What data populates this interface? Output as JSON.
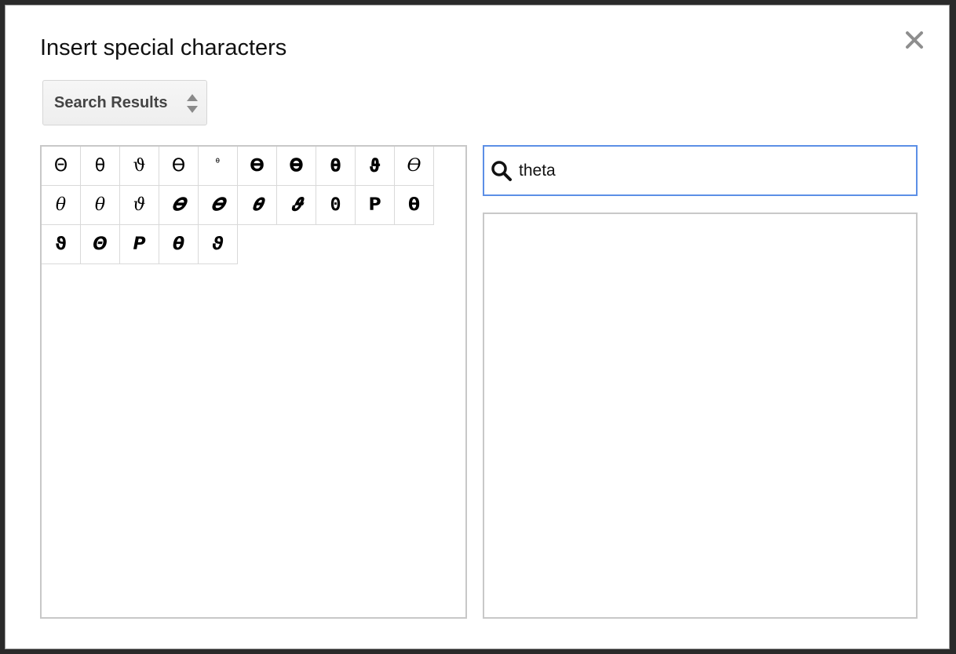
{
  "dialog": {
    "title": "Insert special characters",
    "close_icon": "close-icon"
  },
  "category_select": {
    "selected": "Search Results",
    "icon": "updown-arrows-icon"
  },
  "characters": [
    {
      "glyph": "Θ",
      "style": ""
    },
    {
      "glyph": "θ",
      "style": ""
    },
    {
      "glyph": "ϑ",
      "style": "c-serif"
    },
    {
      "glyph": "ϴ",
      "style": ""
    },
    {
      "glyph": "ᶿ",
      "style": "c-small"
    },
    {
      "glyph": "𝚯",
      "style": "c-bold"
    },
    {
      "glyph": "𝚹",
      "style": "c-bold"
    },
    {
      "glyph": "𝛉",
      "style": "c-bold"
    },
    {
      "glyph": "𝛝",
      "style": "c-bold"
    },
    {
      "glyph": "𝛳",
      "style": "c-italic c-serif"
    },
    {
      "glyph": "𝜃",
      "style": "c-italic c-serif"
    },
    {
      "glyph": "𝜃",
      "style": "c-italic c-serif"
    },
    {
      "glyph": "𝜗",
      "style": "c-italic c-serif"
    },
    {
      "glyph": "𝜭",
      "style": "c-bold c-italic"
    },
    {
      "glyph": "𝜭",
      "style": "c-bold c-italic"
    },
    {
      "glyph": "𝜽",
      "style": "c-bold c-italic"
    },
    {
      "glyph": "𝝑",
      "style": "c-bold c-italic"
    },
    {
      "glyph": "Θ",
      "style": "c-bold c-mono"
    },
    {
      "glyph": "Ρ",
      "style": "c-bold"
    },
    {
      "glyph": "θ",
      "style": "c-bold"
    },
    {
      "glyph": "ϑ",
      "style": "c-bold"
    },
    {
      "glyph": "Θ",
      "style": "c-bold c-italic"
    },
    {
      "glyph": "Ρ",
      "style": "c-bold c-italic"
    },
    {
      "glyph": "θ",
      "style": "c-bold c-italic"
    },
    {
      "glyph": "ϑ",
      "style": "c-bold c-italic"
    }
  ],
  "search": {
    "value": "theta",
    "placeholder": "",
    "icon": "search-icon"
  },
  "draw_panel": {}
}
